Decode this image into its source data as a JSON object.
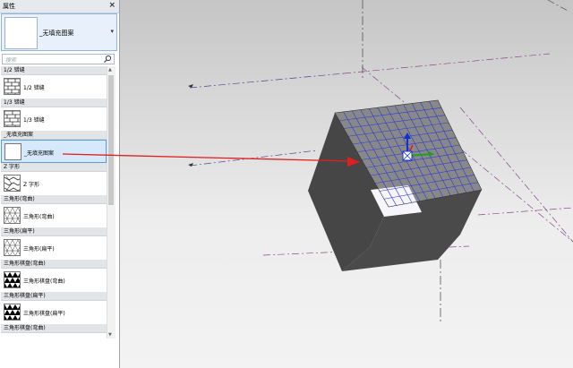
{
  "properties_panel": {
    "title": "属性",
    "close_symbol": "×",
    "type_selector": {
      "current": "_无填充图案",
      "arrow": "▾"
    },
    "search": {
      "placeholder": "搜索"
    },
    "groups": [
      {
        "header": "1/2 错缝",
        "items": [
          {
            "label": "1/2 错缝",
            "pattern": "brick-half"
          }
        ]
      },
      {
        "header": "1/3 错缝",
        "items": [
          {
            "label": "1/3 错缝",
            "pattern": "brick-third"
          }
        ]
      },
      {
        "header": "_无填充图案",
        "items": [
          {
            "label": "_无填充图案",
            "pattern": "none",
            "selected": true
          }
        ]
      },
      {
        "header": "Z 字形",
        "items": [
          {
            "label": "Z 字形",
            "pattern": "zigzag"
          }
        ]
      },
      {
        "header": "三角形(弯曲)",
        "items": [
          {
            "label": "三角形(弯曲)",
            "pattern": "tri-curved"
          }
        ]
      },
      {
        "header": "三角形(扁平)",
        "items": [
          {
            "label": "三角形(扁平)",
            "pattern": "tri-flat"
          }
        ]
      },
      {
        "header": "三角形棋盘(弯曲)",
        "items": [
          {
            "label": "三角形棋盘(弯曲)",
            "pattern": "tri-checker-curved"
          }
        ]
      },
      {
        "header": "三角形棋盘(扁平)",
        "items": [
          {
            "label": "三角形棋盘(扁平)",
            "pattern": "tri-checker-flat"
          }
        ]
      },
      {
        "header": "三角形棋盘(弯曲)",
        "items": []
      }
    ]
  },
  "annotation": {
    "arrow_color": "#e02020"
  },
  "colors": {
    "selection": "#d6e8fb",
    "selection_border": "#5c9de0",
    "grid_blue": "#2a3ad8"
  }
}
